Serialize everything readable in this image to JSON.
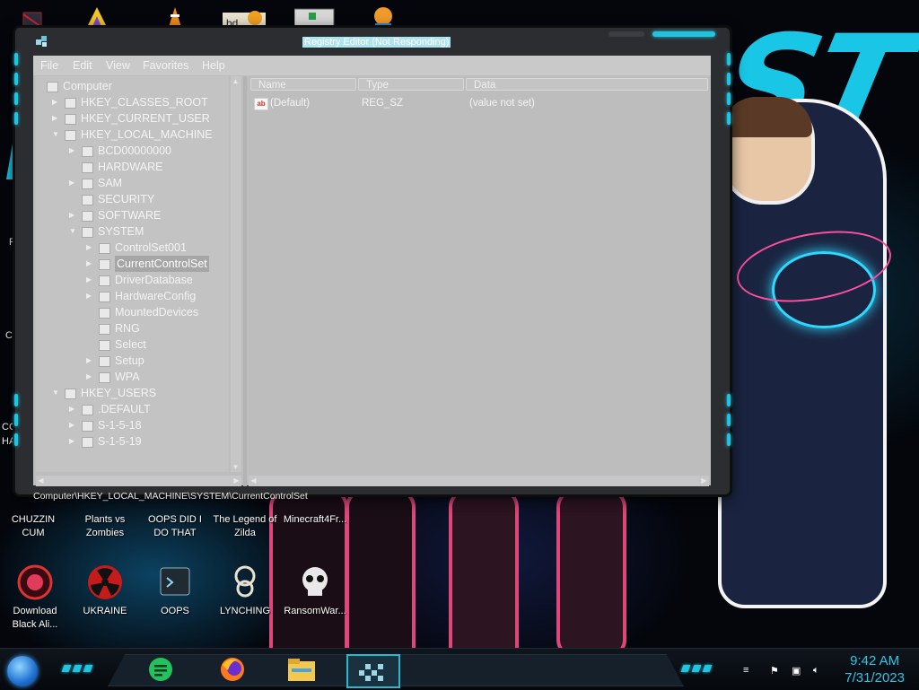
{
  "window": {
    "title": "Registry Editor (Not Responding)",
    "menu": [
      "File",
      "Edit",
      "View",
      "Favorites",
      "Help"
    ],
    "tree": [
      {
        "label": "Computer",
        "level": 0,
        "expander": "▼",
        "selected": false
      },
      {
        "label": "HKEY_CLASSES_ROOT",
        "level": 1,
        "expander": "▶",
        "selected": false
      },
      {
        "label": "HKEY_CURRENT_USER",
        "level": 1,
        "expander": "▶",
        "selected": false
      },
      {
        "label": "HKEY_LOCAL_MACHINE",
        "level": 1,
        "expander": "▼",
        "selected": false
      },
      {
        "label": "BCD00000000",
        "level": 2,
        "expander": "▶",
        "selected": false
      },
      {
        "label": "HARDWARE",
        "level": 2,
        "expander": "",
        "selected": false
      },
      {
        "label": "SAM",
        "level": 2,
        "expander": "▶",
        "selected": false
      },
      {
        "label": "SECURITY",
        "level": 2,
        "expander": "",
        "selected": false
      },
      {
        "label": "SOFTWARE",
        "level": 2,
        "expander": "▶",
        "selected": false
      },
      {
        "label": "SYSTEM",
        "level": 2,
        "expander": "▼",
        "selected": false
      },
      {
        "label": "ControlSet001",
        "level": 3,
        "expander": "▶",
        "selected": false
      },
      {
        "label": "CurrentControlSet",
        "level": 3,
        "expander": "▶",
        "selected": true
      },
      {
        "label": "DriverDatabase",
        "level": 3,
        "expander": "▶",
        "selected": false
      },
      {
        "label": "HardwareConfig",
        "level": 3,
        "expander": "▶",
        "selected": false
      },
      {
        "label": "MountedDevices",
        "level": 3,
        "expander": "",
        "selected": false
      },
      {
        "label": "RNG",
        "level": 3,
        "expander": "",
        "selected": false
      },
      {
        "label": "Select",
        "level": 3,
        "expander": "",
        "selected": false
      },
      {
        "label": "Setup",
        "level": 3,
        "expander": "▶",
        "selected": false
      },
      {
        "label": "WPA",
        "level": 3,
        "expander": "▶",
        "selected": false
      },
      {
        "label": "HKEY_USERS",
        "level": 1,
        "expander": "▼",
        "selected": false
      },
      {
        "label": ".DEFAULT",
        "level": 2,
        "expander": "▶",
        "selected": false
      },
      {
        "label": "S-1-5-18",
        "level": 2,
        "expander": "▶",
        "selected": false
      },
      {
        "label": "S-1-5-19",
        "level": 2,
        "expander": "▶",
        "selected": false
      }
    ],
    "columns": {
      "name": "Name",
      "type": "Type",
      "data": "Data"
    },
    "values": [
      {
        "name": "(Default)",
        "type": "REG_SZ",
        "data": "(value not set)",
        "icon": "string-value-icon"
      }
    ],
    "status_path": "Computer\\HKEY_LOCAL_MACHINE\\SYSTEM\\CurrentControlSet"
  },
  "desktop": {
    "icons_row1": [
      {
        "label": "CHUZZIN CUM",
        "icon": "red-eye-icon"
      },
      {
        "label": "Plants vs Zombies",
        "icon": "game-icon"
      },
      {
        "label": "OOPS DID I DO THAT",
        "icon": "game-icon"
      },
      {
        "label": "The Legend of Zilda",
        "icon": "game-icon"
      },
      {
        "label": "Minecraft4Fr...",
        "icon": "game-icon"
      }
    ],
    "icons_row2": [
      {
        "label": "Download Black Ali...",
        "icon": "red-orb-icon"
      },
      {
        "label": "UKRAINE",
        "icon": "radiation-icon"
      },
      {
        "label": "OOPS",
        "icon": "terminal-icon"
      },
      {
        "label": "LYNCHING",
        "icon": "noose-icon"
      },
      {
        "label": "RansomWar...",
        "icon": "skull-icon"
      }
    ],
    "edge_labels": [
      "Re",
      "Co",
      "CC",
      "HA"
    ]
  },
  "taskbar": {
    "pinned": [
      "notes-app-icon",
      "firefox-icon",
      "file-explorer-icon",
      "registry-editor-icon"
    ],
    "tray": [
      "flag-icon",
      "network-icon",
      "volume-icon"
    ],
    "time": "9:42 AM",
    "date": "7/31/2023"
  },
  "colors": {
    "accent": "#1fc5e0",
    "window_bg": "#bdbdbd",
    "frame": "#2b2d31",
    "clock": "#2ec6e6"
  }
}
